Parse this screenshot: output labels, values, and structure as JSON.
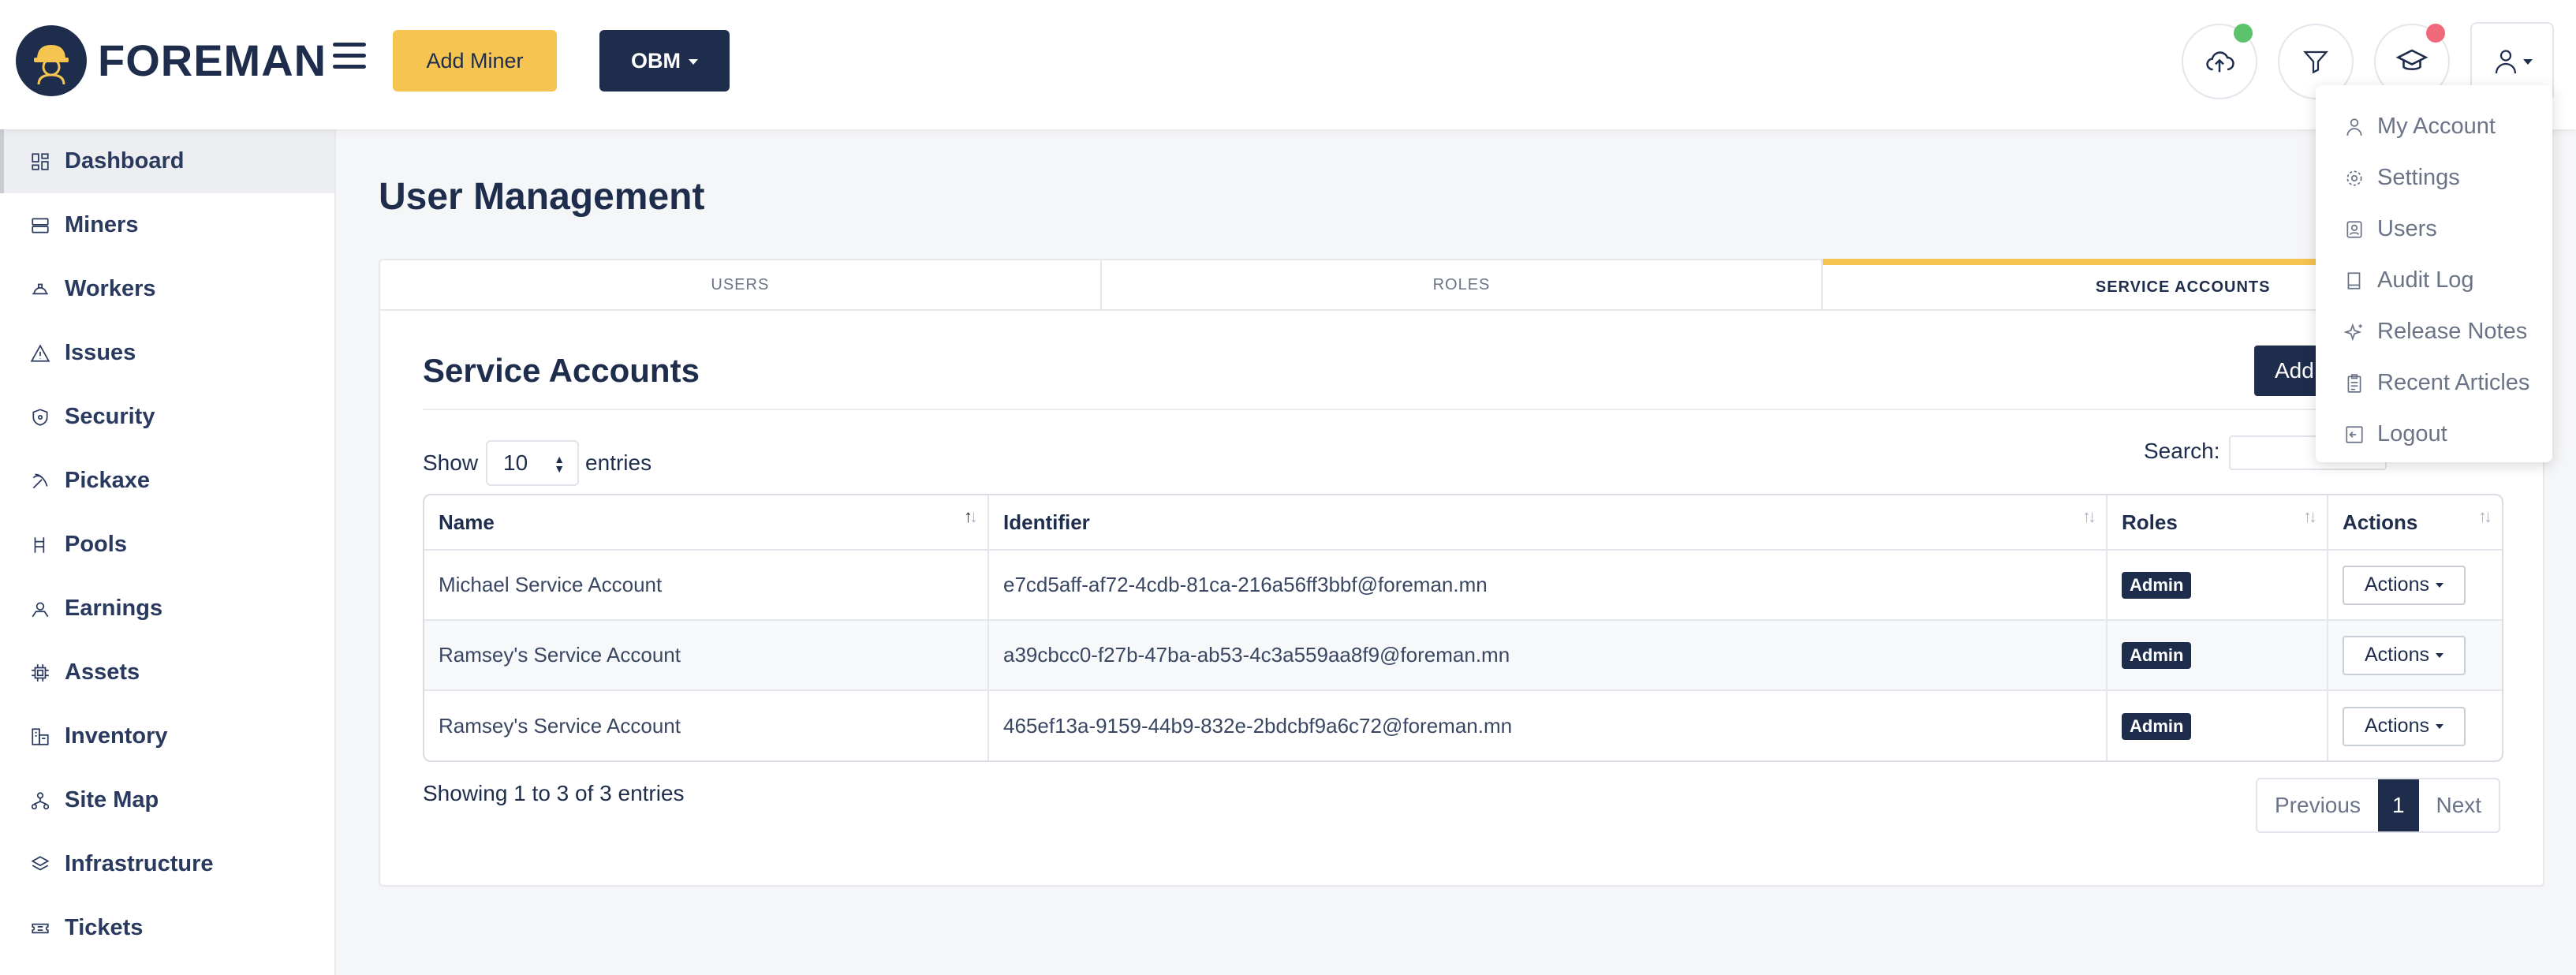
{
  "header": {
    "brand": "FOREMAN",
    "add_miner_label": "Add Miner",
    "org_label": "OBM",
    "status_colors": {
      "upload": "#5cc26b",
      "academy": "#f0697a"
    }
  },
  "sidebar": {
    "items": [
      {
        "label": "Dashboard",
        "icon": "dashboard-icon",
        "active": true
      },
      {
        "label": "Miners",
        "icon": "server-icon"
      },
      {
        "label": "Workers",
        "icon": "helmet-icon"
      },
      {
        "label": "Issues",
        "icon": "warning-icon"
      },
      {
        "label": "Security",
        "icon": "shield-icon"
      },
      {
        "label": "Pickaxe",
        "icon": "pickaxe-icon"
      },
      {
        "label": "Pools",
        "icon": "pools-icon"
      },
      {
        "label": "Earnings",
        "icon": "earnings-icon"
      },
      {
        "label": "Assets",
        "icon": "chip-icon"
      },
      {
        "label": "Inventory",
        "icon": "inventory-icon"
      },
      {
        "label": "Site Map",
        "icon": "sitemap-icon"
      },
      {
        "label": "Infrastructure",
        "icon": "layers-icon"
      },
      {
        "label": "Tickets",
        "icon": "ticket-icon"
      }
    ]
  },
  "main": {
    "title": "User Management",
    "tabs": [
      {
        "label": "USERS"
      },
      {
        "label": "ROLES"
      },
      {
        "label": "SERVICE ACCOUNTS",
        "active": true
      }
    ],
    "section_title": "Service Accounts",
    "add_button": "Add",
    "show_label": "Show",
    "entries_value": "10",
    "entries_label": "entries",
    "search_label": "Search:",
    "table": {
      "columns": [
        "Name",
        "Identifier",
        "Roles",
        "Actions"
      ],
      "rows": [
        {
          "name": "Michael Service Account",
          "identifier": "e7cd5aff-af72-4cdb-81ca-216a56ff3bbf@foreman.mn",
          "role": "Admin",
          "action": "Actions"
        },
        {
          "name": "Ramsey's Service Account",
          "identifier": "a39cbcc0-f27b-47ba-ab53-4c3a559aa8f9@foreman.mn",
          "role": "Admin",
          "action": "Actions"
        },
        {
          "name": "Ramsey's Service Account",
          "identifier": "465ef13a-9159-44b9-832e-2bdcbf9a6c72@foreman.mn",
          "role": "Admin",
          "action": "Actions"
        }
      ]
    },
    "showing_text": "Showing 1 to 3 of 3 entries",
    "pager": {
      "previous": "Previous",
      "current": "1",
      "next": "Next"
    }
  },
  "user_menu": {
    "items": [
      {
        "label": "My Account",
        "icon": "user-icon"
      },
      {
        "label": "Settings",
        "icon": "gear-icon"
      },
      {
        "label": "Users",
        "icon": "users-icon"
      },
      {
        "label": "Audit Log",
        "icon": "book-icon"
      },
      {
        "label": "Release Notes",
        "icon": "sparkle-icon"
      },
      {
        "label": "Recent Articles",
        "icon": "clipboard-icon"
      },
      {
        "label": "Logout",
        "icon": "logout-icon"
      }
    ]
  }
}
